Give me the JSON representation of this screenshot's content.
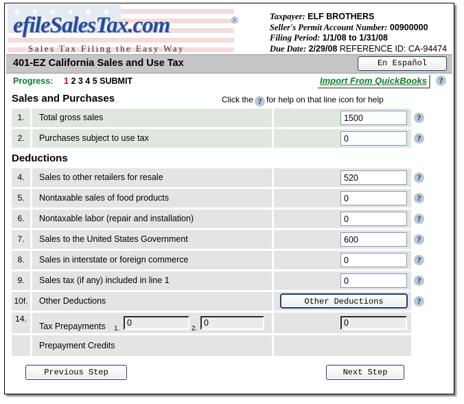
{
  "brand": {
    "logo_text": "efileSalesTax.com",
    "registered_mark": "®",
    "tagline": "Sales Tax Filing the Easy Way"
  },
  "taxpayer": {
    "taxpayer_label": "Taxpayer:",
    "taxpayer_name": "ELF BROTHERS",
    "permit_label": "Seller's Permit Account Number:",
    "permit_number": "00900000",
    "filing_period_label": "Filing Period:",
    "filing_period": "1/1/08 to 1/31/08",
    "due_date_label": "Due Date:",
    "due_date": "2/29/08",
    "reference_label": "REFERENCE ID:",
    "reference_id": "CA-94474"
  },
  "titlebar": {
    "form_title": "401-EZ California Sales and Use Tax",
    "espanol_button": "En Español"
  },
  "progress": {
    "label": "Progress:",
    "current_step": "1",
    "remaining_steps": "2 3 4 5 SUBMIT",
    "quickbooks_button": "Import From QuickBooks",
    "help_icon": "?"
  },
  "sections": {
    "sales_title": "Sales and Purchases",
    "deductions_title": "Deductions",
    "help_hint_before": "Click the",
    "help_hint_after": "for help on that line   icon for help"
  },
  "rows": [
    {
      "num": "1.",
      "label": "Total gross sales",
      "value": "1500",
      "shade": "green"
    },
    {
      "num": "2.",
      "label": "Purchases subject to use tax",
      "value": "0",
      "shade": "green"
    },
    {
      "num": "4.",
      "label": "Sales to other retailers for resale",
      "value": "520",
      "shade": "gray"
    },
    {
      "num": "5.",
      "label": "Nontaxable sales of food products",
      "value": "0",
      "shade": "gray"
    },
    {
      "num": "6.",
      "label": "Nontaxable labor (repair and installation)",
      "value": "0",
      "shade": "gray"
    },
    {
      "num": "7.",
      "label": "Sales to the United States Government",
      "value": "600",
      "shade": "gray"
    },
    {
      "num": "8.",
      "label": "Sales in interstate or foreign commerce",
      "value": "0",
      "shade": "gray"
    },
    {
      "num": "9.",
      "label": "Sales tax (if any) included in line 1",
      "value": "0",
      "shade": "gray"
    }
  ],
  "other_deductions_row": {
    "num": "10f.",
    "label": "Other Deductions",
    "button_label": "Other Deductions"
  },
  "prepayments_row": {
    "num": "14.",
    "label": "Tax Prepayments",
    "sub1_label": "1.",
    "sub1_value": "0",
    "sub2_label": "2.",
    "sub2_value": "0",
    "total_value": "0"
  },
  "credits_row": {
    "label": "Prepayment Credits"
  },
  "footer": {
    "previous_button": "Previous Step",
    "next_button": "Next Step"
  },
  "colors": {
    "title_bar": "#c6c6c6",
    "row_green": "#dfe8de",
    "row_gray": "#e4e4e4",
    "progress_label": "#127a2e",
    "current_step": "#cc0000",
    "logo_blue": "#2b4c9b",
    "button_border": "#1f3d73",
    "help_icon_bg": "#b9c6d6"
  }
}
